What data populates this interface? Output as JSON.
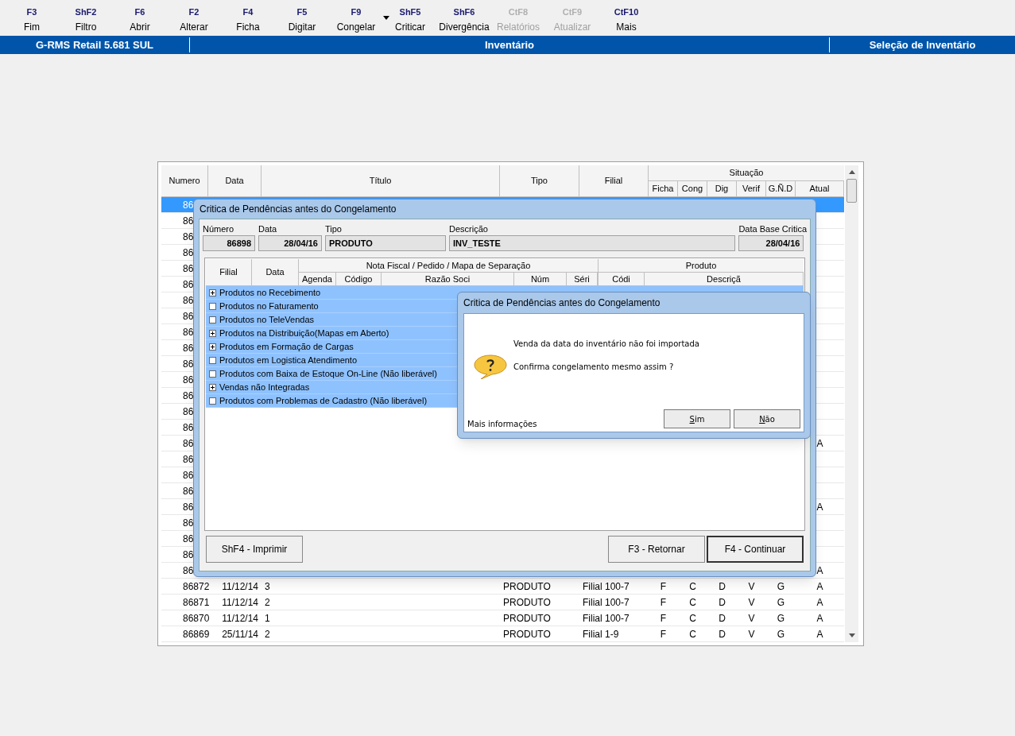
{
  "toolbar": [
    {
      "key": "F3",
      "label": "Fim",
      "disabled": false,
      "has_menu": false
    },
    {
      "key": "ShF2",
      "label": "Filtro",
      "disabled": false,
      "has_menu": false
    },
    {
      "key": "F6",
      "label": "Abrir",
      "disabled": false,
      "has_menu": false
    },
    {
      "key": "F2",
      "label": "Alterar",
      "disabled": false,
      "has_menu": false
    },
    {
      "key": "F4",
      "label": "Ficha",
      "disabled": false,
      "has_menu": false
    },
    {
      "key": "F5",
      "label": "Digitar",
      "disabled": false,
      "has_menu": false
    },
    {
      "key": "F9",
      "label": "Congelar",
      "disabled": false,
      "has_menu": true
    },
    {
      "key": "ShF5",
      "label": "Criticar",
      "disabled": false,
      "has_menu": false
    },
    {
      "key": "ShF6",
      "label": "Divergência",
      "disabled": false,
      "has_menu": false
    },
    {
      "key": "CtF8",
      "label": "Relatórios",
      "disabled": true,
      "has_menu": false
    },
    {
      "key": "CtF9",
      "label": "Atualizar",
      "disabled": true,
      "has_menu": false
    },
    {
      "key": "CtF10",
      "label": "Mais",
      "disabled": false,
      "has_menu": false
    }
  ],
  "header_bar": {
    "app": "G-RMS Retail 5.681 SUL",
    "module": "Inventário",
    "screen": "Seleção de Inventário"
  },
  "table": {
    "columns": [
      "Numero",
      "Data",
      "Título",
      "Tipo",
      "Filial"
    ],
    "group": "Situação",
    "sub_columns": [
      "Ficha",
      "Cong",
      "Dig",
      "Verif",
      "G.Ñ.D",
      "Atual"
    ],
    "rows": [
      {
        "numero": "86",
        "selected": true
      },
      {
        "numero": "86",
        "selected": false
      },
      {
        "numero": "86",
        "selected": false
      },
      {
        "numero": "86",
        "selected": false
      },
      {
        "numero": "86",
        "selected": false
      },
      {
        "numero": "86",
        "selected": false
      },
      {
        "numero": "86",
        "selected": false
      },
      {
        "numero": "86",
        "selected": false
      },
      {
        "numero": "86",
        "selected": false
      },
      {
        "numero": "86",
        "selected": false
      },
      {
        "numero": "86",
        "selected": false
      },
      {
        "numero": "86",
        "selected": false
      },
      {
        "numero": "86",
        "selected": false
      },
      {
        "numero": "86",
        "selected": false
      },
      {
        "numero": "86",
        "selected": false
      },
      {
        "numero": "86",
        "selected": false,
        "atual": "A"
      },
      {
        "numero": "86",
        "selected": false
      },
      {
        "numero": "86",
        "selected": false
      },
      {
        "numero": "86",
        "selected": false
      },
      {
        "numero": "86",
        "selected": false,
        "atual": "A"
      },
      {
        "numero": "86",
        "selected": false
      },
      {
        "numero": "86",
        "selected": false
      },
      {
        "numero": "86",
        "selected": false
      },
      {
        "numero": "86",
        "selected": false,
        "atual": "A"
      },
      {
        "numero": "86872",
        "data": "11/12/14",
        "titulo": "3",
        "tipo": "PRODUTO",
        "filial": "Filial 100-7",
        "ficha": "F",
        "cong": "C",
        "dig": "D",
        "verif": "V",
        "gnd": "G",
        "atual": "A",
        "selected": false
      },
      {
        "numero": "86871",
        "data": "11/12/14",
        "titulo": "2",
        "tipo": "PRODUTO",
        "filial": "Filial 100-7",
        "ficha": "F",
        "cong": "C",
        "dig": "D",
        "verif": "V",
        "gnd": "G",
        "atual": "A",
        "selected": false
      },
      {
        "numero": "86870",
        "data": "11/12/14",
        "titulo": "1",
        "tipo": "PRODUTO",
        "filial": "Filial 100-7",
        "ficha": "F",
        "cong": "C",
        "dig": "D",
        "verif": "V",
        "gnd": "G",
        "atual": "A",
        "selected": false
      },
      {
        "numero": "86869",
        "data": "25/11/14",
        "titulo": "2",
        "tipo": "PRODUTO",
        "filial": "Filial 1-9",
        "ficha": "F",
        "cong": "C",
        "dig": "D",
        "verif": "V",
        "gnd": "G",
        "atual": "A",
        "selected": false
      }
    ]
  },
  "dialog": {
    "title": "Critica de Pendências antes do Congelamento",
    "fields": [
      {
        "label": "Número",
        "value": "86898",
        "kind": "number"
      },
      {
        "label": "Data",
        "value": "28/04/16",
        "kind": "date"
      },
      {
        "label": "Tipo",
        "value": "PRODUTO",
        "kind": "text"
      },
      {
        "label": "Descrição",
        "value": "INV_TESTE",
        "kind": "text"
      },
      {
        "label": "Data Base Critica",
        "value": "28/04/16",
        "kind": "date"
      }
    ],
    "grid_headers": {
      "filial": "Filial",
      "data": "Data",
      "group_1": "Nota Fiscal / Pedido / Mapa de Separação",
      "group_2": "Produto",
      "sub_1": [
        "Agenda",
        "Código",
        "Razão Soci",
        "Núm",
        "Séri"
      ],
      "sub_2": [
        "Códi",
        "Descriçã"
      ]
    },
    "items": [
      {
        "kind": "expandable",
        "label": "Produtos no Recebimento"
      },
      {
        "kind": "leaf",
        "label": "Produtos no Faturamento"
      },
      {
        "kind": "leaf",
        "label": "Produtos no TeleVendas"
      },
      {
        "kind": "expandable",
        "label": "Produtos na Distribuição(Mapas em Aberto)"
      },
      {
        "kind": "expandable",
        "label": "Produtos em Formação de Cargas"
      },
      {
        "kind": "leaf",
        "label": "Produtos em Logistica Atendimento"
      },
      {
        "kind": "leaf",
        "label": "Produtos com Baixa de Estoque On-Line (Não liberável)"
      },
      {
        "kind": "expandable",
        "label": "Vendas não Integradas"
      },
      {
        "kind": "leaf",
        "label": "Produtos com Problemas de Cadastro (Não liberável)"
      }
    ],
    "left_buttons": [
      {
        "label": "ShF4 - Imprimir",
        "default": false
      }
    ],
    "right_buttons": [
      {
        "label": "F3 - Retornar",
        "default": false
      },
      {
        "label": "F4 - Continuar",
        "default": true
      }
    ]
  },
  "message_box": {
    "title": "Critica de Pendências antes do Congelamento",
    "lines": [
      "Venda da data do inventário não foi importada",
      "Confirma congelamento mesmo assim ?"
    ],
    "more": "Mais informações",
    "buttons": [
      "Sim",
      "Não"
    ]
  }
}
